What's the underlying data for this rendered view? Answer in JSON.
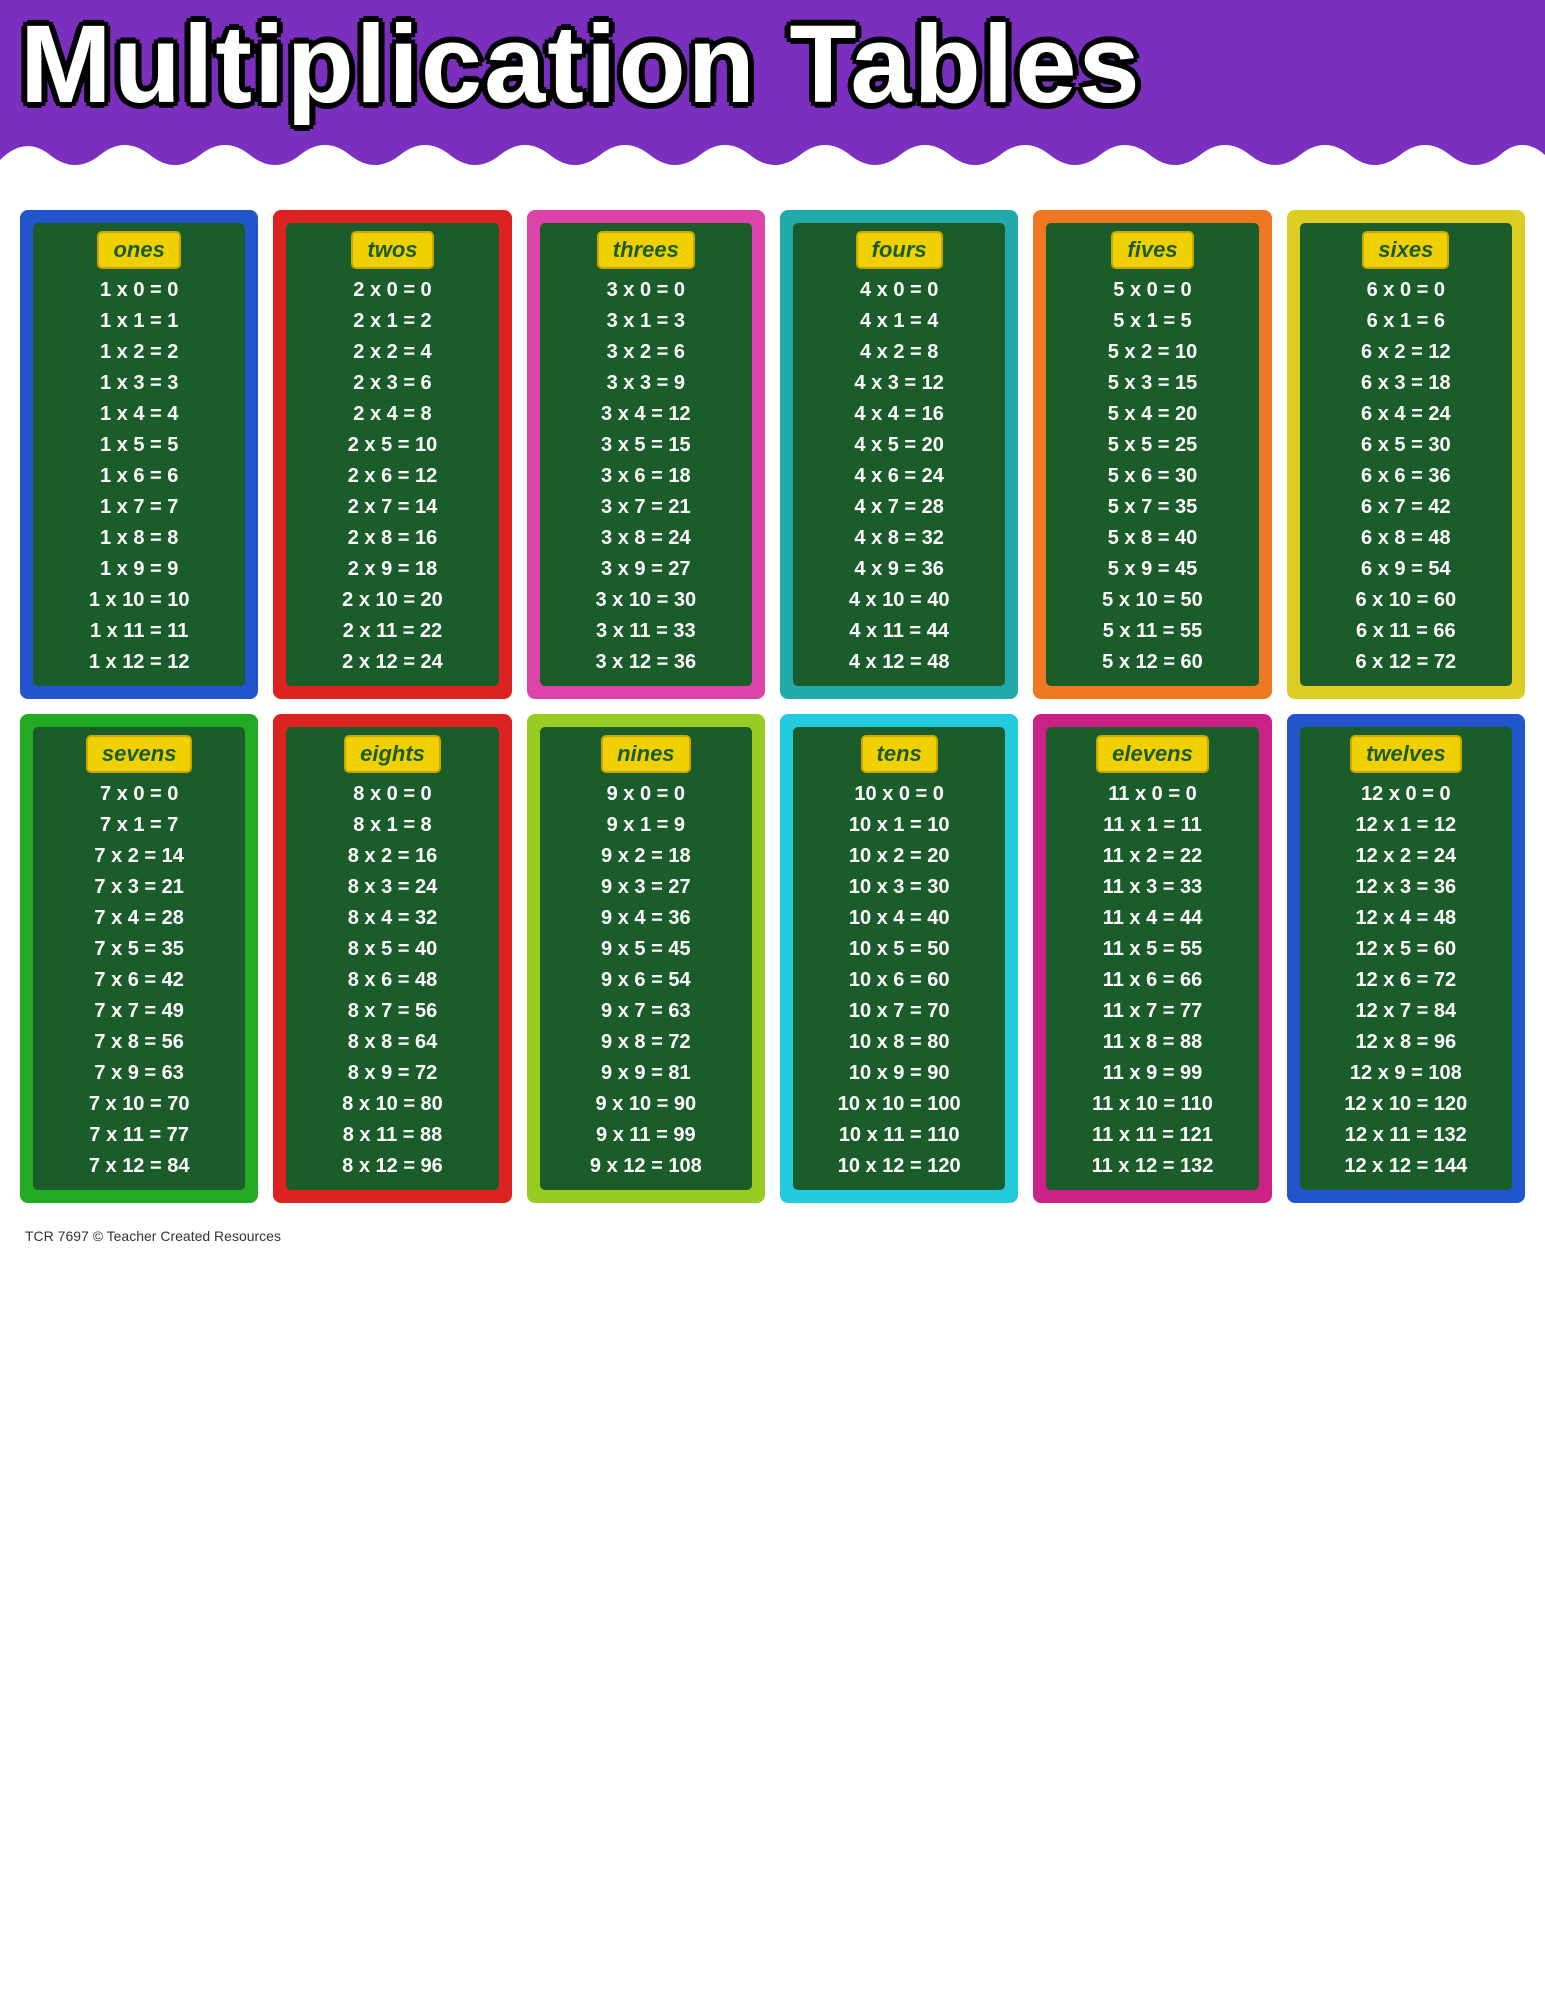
{
  "header": {
    "title": "Multiplication Tables",
    "bg_color": "#7b2fbe"
  },
  "tables": [
    {
      "label": "ones",
      "border_class": "card-blue",
      "multiplier": 1,
      "rows": [
        "1 x 0 = 0",
        "1 x 1 = 1",
        "1 x 2 = 2",
        "1 x 3 = 3",
        "1 x 4 = 4",
        "1 x 5 = 5",
        "1 x 6 = 6",
        "1 x 7 = 7",
        "1 x 8 = 8",
        "1 x 9 = 9",
        "1 x 10 = 10",
        "1 x 11 = 11",
        "1 x 12 = 12"
      ]
    },
    {
      "label": "twos",
      "border_class": "card-red",
      "multiplier": 2,
      "rows": [
        "2 x 0 = 0",
        "2 x 1 = 2",
        "2 x 2 = 4",
        "2 x 3 = 6",
        "2 x 4 = 8",
        "2 x 5 = 10",
        "2 x 6 = 12",
        "2 x 7 = 14",
        "2 x 8 = 16",
        "2 x 9 = 18",
        "2 x 10 = 20",
        "2 x 11 = 22",
        "2 x 12 = 24"
      ]
    },
    {
      "label": "threes",
      "border_class": "card-pink",
      "multiplier": 3,
      "rows": [
        "3 x 0 = 0",
        "3 x 1 = 3",
        "3 x 2 = 6",
        "3 x 3 = 9",
        "3 x 4 = 12",
        "3 x 5 = 15",
        "3 x 6 = 18",
        "3 x 7 = 21",
        "3 x 8 = 24",
        "3 x 9 = 27",
        "3 x 10 = 30",
        "3 x 11 = 33",
        "3 x 12 = 36"
      ]
    },
    {
      "label": "fours",
      "border_class": "card-teal",
      "multiplier": 4,
      "rows": [
        "4 x 0 = 0",
        "4 x 1 = 4",
        "4 x 2 = 8",
        "4 x 3 = 12",
        "4 x 4 = 16",
        "4 x 5 = 20",
        "4 x 6 = 24",
        "4 x 7 = 28",
        "4 x 8 = 32",
        "4 x 9 = 36",
        "4 x 10 = 40",
        "4 x 11 = 44",
        "4 x 12 = 48"
      ]
    },
    {
      "label": "fives",
      "border_class": "card-orange",
      "multiplier": 5,
      "rows": [
        "5 x 0 = 0",
        "5 x 1 = 5",
        "5 x 2 = 10",
        "5 x 3 = 15",
        "5 x 4 = 20",
        "5 x 5 = 25",
        "5 x 6 = 30",
        "5 x 7 = 35",
        "5 x 8 = 40",
        "5 x 9 = 45",
        "5 x 10 = 50",
        "5 x 11 = 55",
        "5 x 12 = 60"
      ]
    },
    {
      "label": "sixes",
      "border_class": "card-yellow",
      "multiplier": 6,
      "rows": [
        "6 x 0 = 0",
        "6 x 1 = 6",
        "6 x 2 = 12",
        "6 x 3 = 18",
        "6 x 4 = 24",
        "6 x 5 = 30",
        "6 x 6 = 36",
        "6 x 7 = 42",
        "6 x 8 = 48",
        "6 x 9 = 54",
        "6 x 10 = 60",
        "6 x 11 = 66",
        "6 x 12 = 72"
      ]
    },
    {
      "label": "sevens",
      "border_class": "card-green",
      "multiplier": 7,
      "rows": [
        "7 x 0 = 0",
        "7 x 1 = 7",
        "7 x 2 = 14",
        "7 x 3 = 21",
        "7 x 4 = 28",
        "7 x 5 = 35",
        "7 x 6 = 42",
        "7 x 7 = 49",
        "7 x 8 = 56",
        "7 x 9 = 63",
        "7 x 10 = 70",
        "7 x 11 = 77",
        "7 x 12 = 84"
      ]
    },
    {
      "label": "eights",
      "border_class": "card-red",
      "multiplier": 8,
      "rows": [
        "8 x 0 = 0",
        "8 x 1 = 8",
        "8 x 2 = 16",
        "8 x 3 = 24",
        "8 x 4 = 32",
        "8 x 5 = 40",
        "8 x 6 = 48",
        "8 x 7 = 56",
        "8 x 8 = 64",
        "8 x 9 = 72",
        "8 x 10 = 80",
        "8 x 11 = 88",
        "8 x 12 = 96"
      ]
    },
    {
      "label": "nines",
      "border_class": "card-lime",
      "multiplier": 9,
      "rows": [
        "9 x 0 = 0",
        "9 x 1 = 9",
        "9 x 2 = 18",
        "9 x 3 = 27",
        "9 x 4 = 36",
        "9 x 5 = 45",
        "9 x 6 = 54",
        "9 x 7 = 63",
        "9 x 8 = 72",
        "9 x 9 = 81",
        "9 x 10 = 90",
        "9 x 11 = 99",
        "9 x 12 = 108"
      ]
    },
    {
      "label": "tens",
      "border_class": "card-cyan",
      "multiplier": 10,
      "rows": [
        "10 x 0 = 0",
        "10 x 1 = 10",
        "10 x 2 = 20",
        "10 x 3 = 30",
        "10 x 4 = 40",
        "10 x 5 = 50",
        "10 x 6 = 60",
        "10 x 7 = 70",
        "10 x 8 = 80",
        "10 x 9 = 90",
        "10 x 10 = 100",
        "10 x 11 = 110",
        "10 x 12 = 120"
      ]
    },
    {
      "label": "elevens",
      "border_class": "card-magenta",
      "multiplier": 11,
      "rows": [
        "11 x 0 = 0",
        "11 x 1 = 11",
        "11 x 2 = 22",
        "11 x 3 = 33",
        "11 x 4 = 44",
        "11 x 5 = 55",
        "11 x 6 = 66",
        "11 x 7 = 77",
        "11 x 8 = 88",
        "11 x 9 = 99",
        "11 x 10 = 110",
        "11 x 11 = 121",
        "11 x 12 = 132"
      ]
    },
    {
      "label": "twelves",
      "border_class": "card-blue",
      "multiplier": 12,
      "rows": [
        "12 x 0 = 0",
        "12 x 1 = 12",
        "12 x 2 = 24",
        "12 x 3 = 36",
        "12 x 4 = 48",
        "12 x 5 = 60",
        "12 x 6 = 72",
        "12 x 7 = 84",
        "12 x 8 = 96",
        "12 x 9 = 108",
        "12 x 10 = 120",
        "12 x 11 = 132",
        "12 x 12 = 144"
      ]
    }
  ],
  "footer": {
    "text": "TCR 7697  © Teacher Created Resources"
  }
}
